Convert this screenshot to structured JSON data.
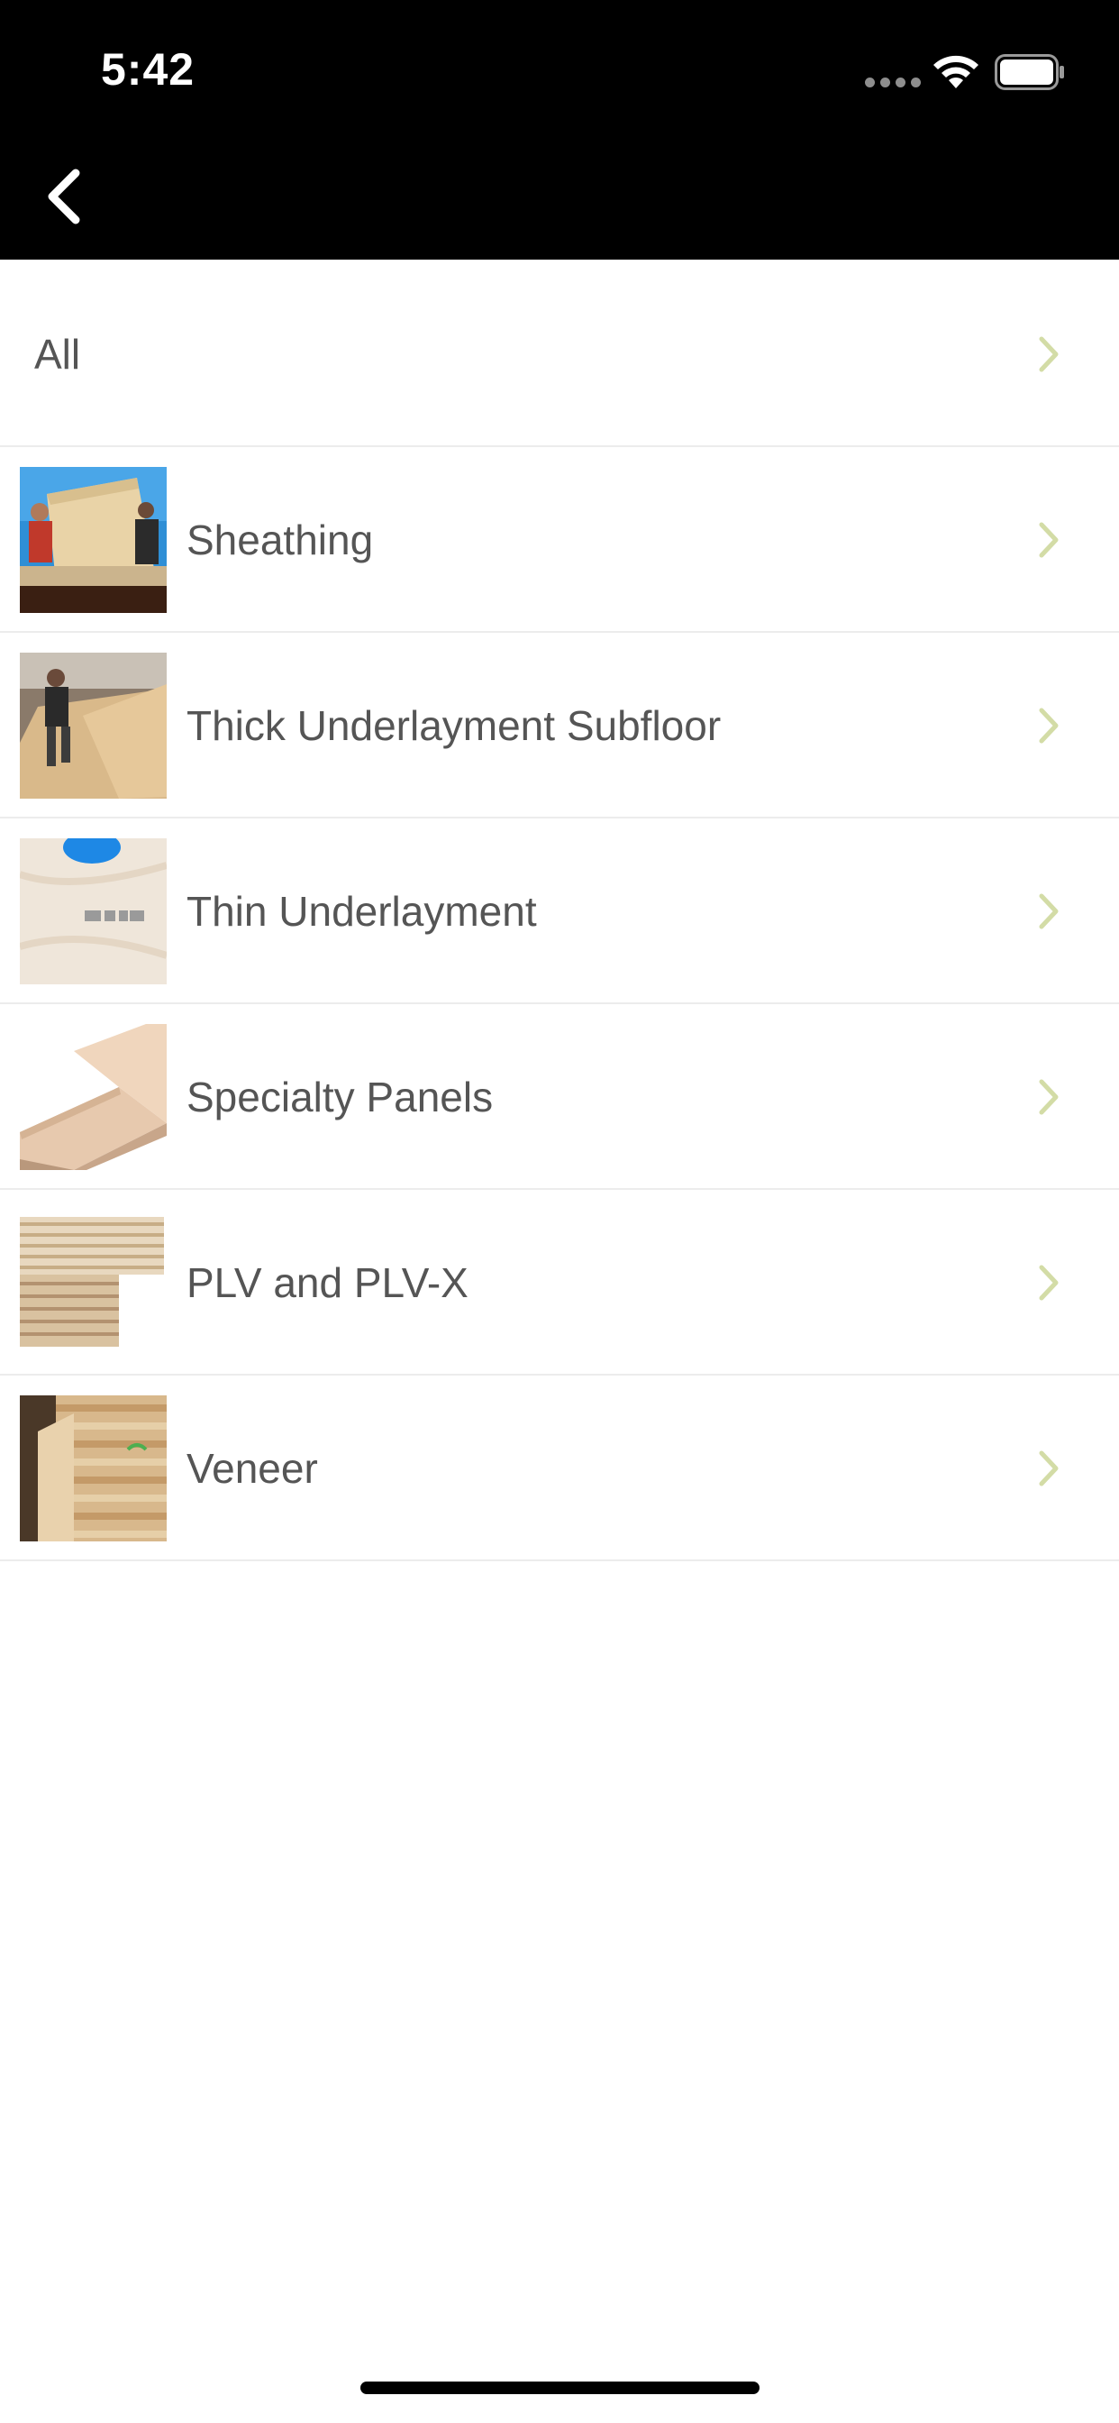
{
  "status_bar": {
    "time": "5:42"
  },
  "nav": {
    "back_icon": "chevron-left-icon"
  },
  "list": {
    "all_label": "All",
    "items": [
      {
        "label": "Sheathing",
        "thumb": "sheathing-photo"
      },
      {
        "label": "Thick Underlayment Subfloor",
        "thumb": "subfloor-photo"
      },
      {
        "label": "Thin Underlayment",
        "thumb": "thin-underlayment-photo"
      },
      {
        "label": "Specialty Panels",
        "thumb": "specialty-panels-photo"
      },
      {
        "label": "PLV and PLV-X",
        "thumb": "plv-photo"
      },
      {
        "label": "Veneer",
        "thumb": "veneer-photo"
      }
    ]
  },
  "colors": {
    "header_bg": "#000000",
    "chevron": "#d3dca6",
    "label_text": "#555555",
    "divider": "#ececec"
  }
}
